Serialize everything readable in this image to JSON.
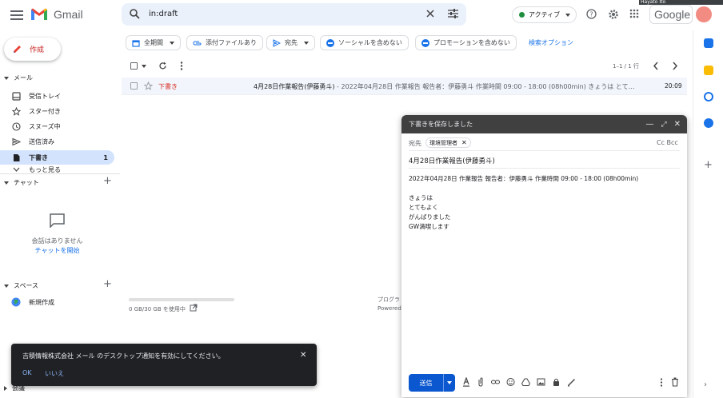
{
  "header": {
    "brand": "Gmail",
    "search_value": "in:draft",
    "status_label": "アクティブ",
    "google_label": "Google",
    "video_name": "Hayato Ito"
  },
  "sidebar": {
    "compose_label": "作成",
    "mail_section": "メール",
    "items": [
      {
        "label": "受信トレイ",
        "icon": "inbox-icon",
        "count": ""
      },
      {
        "label": "スター付き",
        "icon": "star-icon",
        "count": ""
      },
      {
        "label": "スヌーズ中",
        "icon": "clock-icon",
        "count": ""
      },
      {
        "label": "送信済み",
        "icon": "send-icon",
        "count": ""
      },
      {
        "label": "下書き",
        "icon": "draft-icon",
        "count": "1"
      },
      {
        "label": "もっと見る",
        "icon": "more-icon",
        "count": ""
      }
    ],
    "chat_section": "チャット",
    "chat_empty": "会話はありません",
    "chat_start": "チャットを開始",
    "spaces_section": "スペース",
    "new_space": "新規作成",
    "meet_section": "会議"
  },
  "filters": {
    "period": "全期間",
    "attachment": "添付ファイルあり",
    "to": "宛先",
    "no_social": "ソーシャルを含めない",
    "no_promo": "プロモーションを含めない",
    "options": "検索オプション"
  },
  "list": {
    "pagination": "1–1 / 1 行",
    "rows": [
      {
        "sender": "下書き",
        "subject": "4月28日作業報告(伊藤勇斗)",
        "snippet": " - 2022年04月28日 作業報告 報告者：伊藤勇斗 作業時間 09:00 - 18:00 (08h00min) きょうは とて…",
        "time": "20:09"
      }
    ]
  },
  "storage": {
    "used": "0 GB/30 GB を使用中",
    "fraction": 0.0,
    "program": "プログラ",
    "powered": "Powered"
  },
  "compose": {
    "title": "下書きを保存しました",
    "to_label": "宛先",
    "recipient": "環境管理者",
    "cc_bcc": "Cc Bcc",
    "subject": "4月28日作業報告(伊藤勇斗)",
    "body_first": "2022年04月28日 作業報告 報告者：伊藤勇斗 作業時間 09:00 - 18:00 (08h00min)",
    "body_lines": [
      "きょうは",
      "とてもよく",
      "がんばりました",
      "GW満喫します"
    ],
    "send_label": "送信"
  },
  "snackbar": {
    "message": "吉積情報株式会社 メール のデスクトップ通知を有効にしてください。",
    "ok": "OK",
    "no": "いいえ"
  },
  "colors": {
    "accent": "#1a73e8",
    "compose_red": "#c5221f",
    "active_nav": "#d3e3fd",
    "status_green": "#1e8e3e"
  }
}
